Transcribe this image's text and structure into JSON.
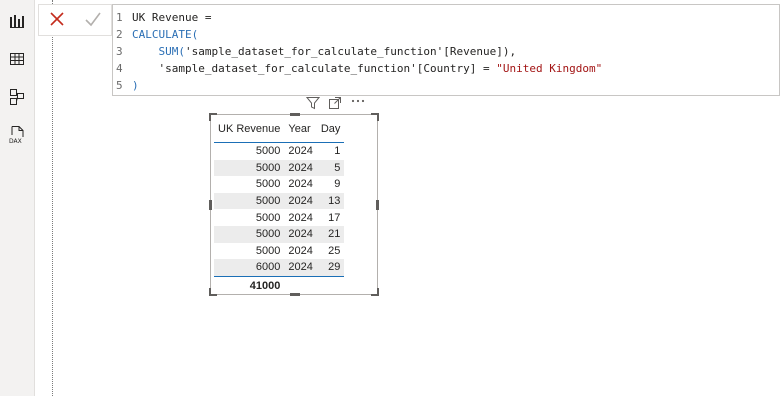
{
  "formula": {
    "line_numbers": [
      "1",
      "2",
      "3",
      "4",
      "5"
    ],
    "line1": "UK Revenue =",
    "line2": "CALCULATE(",
    "line3_func": "SUM(",
    "line3_ref": "'sample_dataset_for_calculate_function'[Revenue]),",
    "line4_ref": "'sample_dataset_for_calculate_function'[Country] = ",
    "line4_str": "\"United Kingdom\"",
    "line5": ")"
  },
  "rail": {
    "icons": [
      "report-view-icon",
      "table-view-icon",
      "model-view-icon",
      "dax-query-view-icon"
    ],
    "dax_label": "DAX"
  },
  "table": {
    "headers": [
      "UK Revenue",
      "Year",
      "Day"
    ],
    "rows": [
      [
        "5000",
        "2024",
        "1"
      ],
      [
        "5000",
        "2024",
        "5"
      ],
      [
        "5000",
        "2024",
        "9"
      ],
      [
        "5000",
        "2024",
        "13"
      ],
      [
        "5000",
        "2024",
        "17"
      ],
      [
        "5000",
        "2024",
        "21"
      ],
      [
        "5000",
        "2024",
        "25"
      ],
      [
        "6000",
        "2024",
        "29"
      ]
    ],
    "total": "41000"
  },
  "colors": {
    "accent_blue": "#1b6fb6",
    "cancel_red": "#c42b1c",
    "keyword_blue": "#2b6fb5",
    "string_red": "#a31515"
  }
}
